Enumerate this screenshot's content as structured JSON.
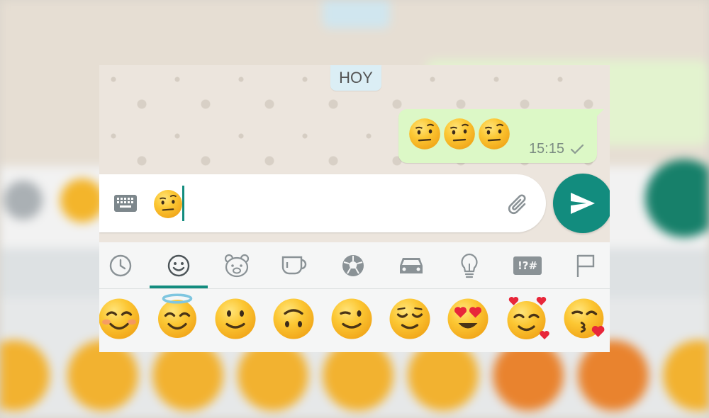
{
  "chat": {
    "date_label": "HOY",
    "message": {
      "emojis": [
        "face-with-raised-eyebrow",
        "face-with-raised-eyebrow",
        "face-with-raised-eyebrow"
      ],
      "time": "15:15",
      "status_icon": "single-check-icon"
    }
  },
  "composer": {
    "keyboard_icon": "keyboard-icon",
    "typed_emoji": "face-with-raised-eyebrow",
    "attach_icon": "paperclip-icon",
    "send_icon": "send-arrow-icon"
  },
  "emoji_tabs": [
    {
      "icon": "recent-clock-icon",
      "selected": false
    },
    {
      "icon": "smiley-icon",
      "selected": true
    },
    {
      "icon": "bear-animal-icon",
      "selected": false
    },
    {
      "icon": "coffee-cup-icon",
      "selected": false
    },
    {
      "icon": "soccer-ball-icon",
      "selected": false
    },
    {
      "icon": "car-icon",
      "selected": false
    },
    {
      "icon": "lightbulb-icon",
      "selected": false
    },
    {
      "icon": "symbols-icon",
      "label": "!?#",
      "selected": false
    },
    {
      "icon": "flag-icon",
      "selected": false
    }
  ],
  "emoji_grid": [
    "smiling-face-with-smiling-eyes",
    "smiling-face-with-halo",
    "slightly-smiling-face",
    "upside-down-face",
    "winking-face",
    "relieved-face",
    "smiling-face-with-heart-eyes",
    "smiling-face-with-hearts",
    "face-blowing-a-kiss"
  ],
  "colors": {
    "accent": "#128c7e",
    "outgoing_bubble": "#dcf8c6",
    "chat_background": "#ece5dd",
    "date_chip": "#dbeef5"
  }
}
